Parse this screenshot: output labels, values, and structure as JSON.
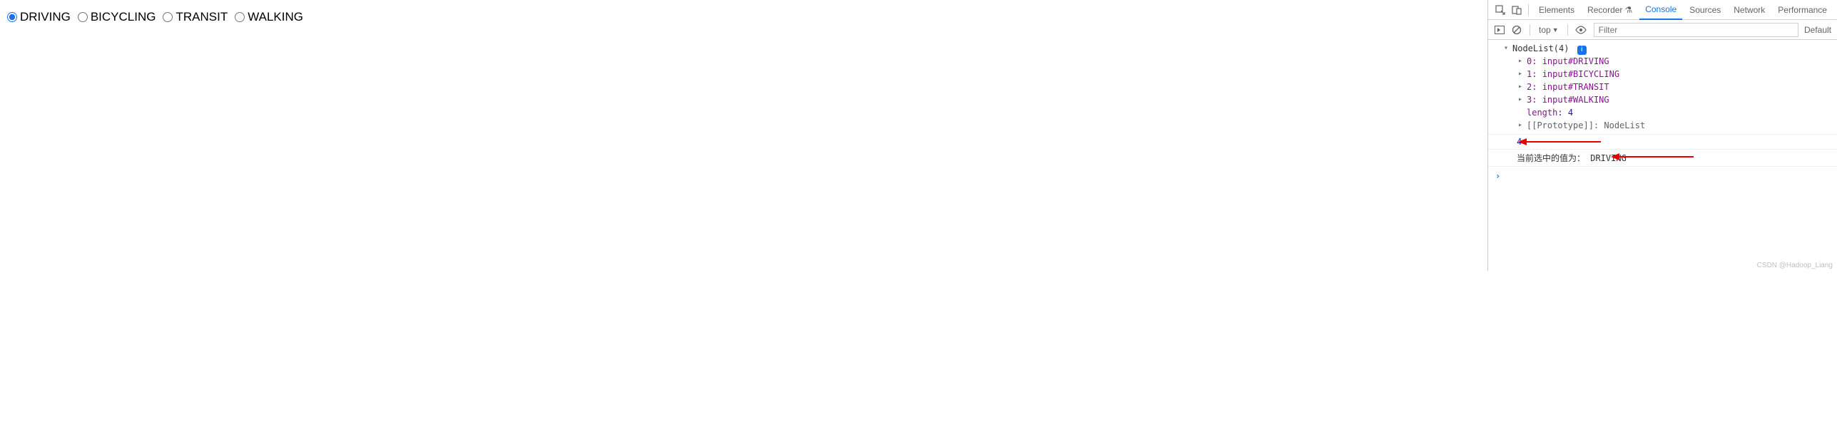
{
  "page": {
    "radios": [
      {
        "label": "DRIVING",
        "checked": true
      },
      {
        "label": "BICYCLING",
        "checked": false
      },
      {
        "label": "TRANSIT",
        "checked": false
      },
      {
        "label": "WALKING",
        "checked": false
      }
    ]
  },
  "devtools": {
    "tabs": {
      "elements": "Elements",
      "recorder": "Recorder",
      "console": "Console",
      "sources": "Sources",
      "network": "Network",
      "performance": "Performance"
    },
    "toolbar": {
      "context": "top",
      "filter_placeholder": "Filter",
      "levels": "Default"
    },
    "console": {
      "nodelist_label": "NodeList(4)",
      "items": [
        {
          "index": "0",
          "type": "input",
          "id": "DRIVING"
        },
        {
          "index": "1",
          "type": "input",
          "id": "BICYCLING"
        },
        {
          "index": "2",
          "type": "input",
          "id": "TRANSIT"
        },
        {
          "index": "3",
          "type": "input",
          "id": "WALKING"
        }
      ],
      "length_key": "length",
      "length_value": "4",
      "prototype_key": "[[Prototype]]",
      "prototype_value": "NodeList",
      "number_output": "4",
      "text_output_prefix": "当前选中的值为：  ",
      "text_output_value": "DRIVING"
    }
  },
  "watermark": "CSDN @Hadoop_Liang"
}
